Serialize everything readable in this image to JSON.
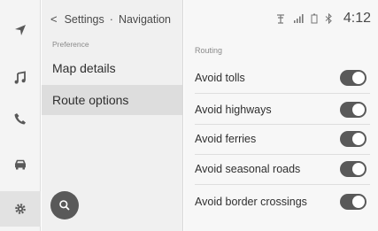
{
  "header": {
    "back_icon": "chevron-left-icon",
    "breadcrumb": [
      "Settings",
      "Navigation"
    ],
    "separator": "·"
  },
  "sidebar": {
    "section_label": "Preference",
    "items": [
      {
        "label": "Map details",
        "selected": false
      },
      {
        "label": "Route options",
        "selected": true
      }
    ],
    "search_icon": "search-icon"
  },
  "rail": {
    "icons": [
      "navigation-arrow-icon",
      "music-note-icon",
      "phone-icon",
      "car-icon",
      "gear-icon"
    ],
    "active": "gear-icon"
  },
  "status_bar": {
    "icons": [
      "gps-antenna-icon",
      "signal-bars-icon",
      "battery-icon",
      "bluetooth-icon"
    ],
    "time": "4:12"
  },
  "routing": {
    "section_label": "Routing",
    "options": [
      {
        "label": "Avoid tolls",
        "enabled": true
      },
      {
        "label": "Avoid highways",
        "enabled": true
      },
      {
        "label": "Avoid ferries",
        "enabled": true
      },
      {
        "label": "Avoid seasonal roads",
        "enabled": true
      },
      {
        "label": "Avoid border crossings",
        "enabled": true
      }
    ]
  },
  "colors": {
    "toggle_on": "#595959",
    "selected_item": "#dddddd",
    "fab": "#595959"
  }
}
